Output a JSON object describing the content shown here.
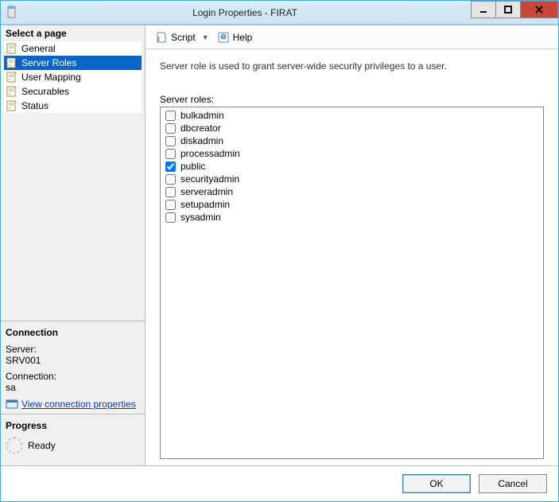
{
  "window": {
    "title": "Login Properties - FIRAT"
  },
  "sidebar": {
    "header": "Select a page",
    "items": [
      {
        "label": "General",
        "selected": false
      },
      {
        "label": "Server Roles",
        "selected": true
      },
      {
        "label": "User Mapping",
        "selected": false
      },
      {
        "label": "Securables",
        "selected": false
      },
      {
        "label": "Status",
        "selected": false
      }
    ]
  },
  "connection": {
    "header": "Connection",
    "server_label": "Server:",
    "server_value": "SRV001",
    "conn_label": "Connection:",
    "conn_value": "sa",
    "link_text": "View connection properties"
  },
  "progress": {
    "header": "Progress",
    "status": "Ready"
  },
  "toolbar": {
    "script_label": "Script",
    "help_label": "Help"
  },
  "main": {
    "description": "Server role is used to grant server-wide security privileges to a user.",
    "list_label": "Server roles:",
    "roles": [
      {
        "name": "bulkadmin",
        "checked": false
      },
      {
        "name": "dbcreator",
        "checked": false
      },
      {
        "name": "diskadmin",
        "checked": false
      },
      {
        "name": "processadmin",
        "checked": false
      },
      {
        "name": "public",
        "checked": true
      },
      {
        "name": "securityadmin",
        "checked": false
      },
      {
        "name": "serveradmin",
        "checked": false
      },
      {
        "name": "setupadmin",
        "checked": false
      },
      {
        "name": "sysadmin",
        "checked": false
      }
    ]
  },
  "buttons": {
    "ok": "OK",
    "cancel": "Cancel"
  }
}
